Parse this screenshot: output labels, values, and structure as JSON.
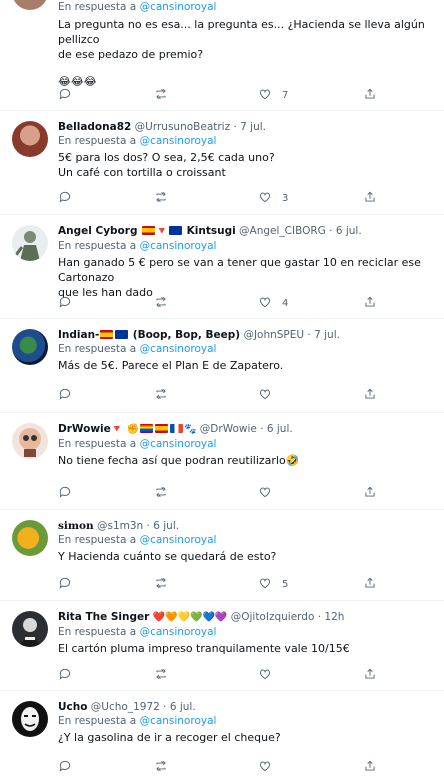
{
  "tweets": [
    {
      "id": "t0",
      "reply_prefix": "En respuesta a ",
      "reply_to": "@cansinoroyal",
      "text_lines": [
        "La pregunta no es esa... la pregunta es... ¿Hacienda se lleva algún pellizco",
        "de ese pedazo de premio?"
      ],
      "emoji_line": "😂😂😂",
      "likes": "7"
    },
    {
      "id": "t1",
      "name": "Belladona82",
      "handle": "@UrrusunoBeatriz",
      "date": "7 jul.",
      "reply_prefix": "En respuesta a ",
      "reply_to": "@cansinoroyal",
      "text_lines": [
        "5€ para los dos? O sea, 2,5€ cada uno?",
        "Un café con tortilla o croissant"
      ],
      "likes": "3"
    },
    {
      "id": "t2",
      "name": "Angel Cyborg",
      "name_suffix": "Kintsugi",
      "handle": "@Angel_CIBORG",
      "date": "6 jul.",
      "reply_prefix": "En respuesta a ",
      "reply_to": "@cansinoroyal",
      "text_lines": [
        "Han ganado 5 € pero se van a tener que gastar 10 en reciclar ese Cartonazo",
        "que les han dado"
      ],
      "likes": "4"
    },
    {
      "id": "t3",
      "name": "Indian-",
      "name_suffix": "(Boop, Bop, Beep)",
      "handle": "@JohnSPEU",
      "date": "7 jul.",
      "reply_prefix": "En respuesta a ",
      "reply_to": "@cansinoroyal",
      "text_lines": [
        "Más de 5€. Parece el Plan E de Zapatero."
      ],
      "likes": ""
    },
    {
      "id": "t4",
      "name": "DrWowie",
      "handle": "@DrWowie",
      "date": "6 jul.",
      "reply_prefix": "En respuesta a ",
      "reply_to": "@cansinoroyal",
      "text_lines": [
        "No tiene fecha así que podran reutilizarlo🤣"
      ],
      "likes": ""
    },
    {
      "id": "t5",
      "name": "simon",
      "handle": "@s1m3n",
      "date": "6 jul.",
      "reply_prefix": "En respuesta a ",
      "reply_to": "@cansinoroyal",
      "text_lines": [
        "Y Hacienda cuánto se quedará de esto?"
      ],
      "likes": "5"
    },
    {
      "id": "t6",
      "name": "Rita The Singer",
      "name_suffix": "❤️🧡💛💚💙💜",
      "handle": "@OjitoIzquierdo",
      "date": "12h",
      "reply_prefix": "En respuesta a ",
      "reply_to": "@cansinoroyal",
      "text_lines": [
        "El cartón pluma impreso tranquilamente vale 10/15€"
      ],
      "likes": ""
    },
    {
      "id": "t7",
      "name": "Ucho",
      "handle": "@Ucho_1972",
      "date": "6 jul.",
      "reply_prefix": "En respuesta a ",
      "reply_to": "@cansinoroyal",
      "text_lines": [
        "¿Y la gasolina de ir a recoger el cheque?"
      ],
      "likes": ""
    }
  ],
  "separator": " · ",
  "colors": {
    "accent": "#1d9bf0",
    "muted": "#536471",
    "text": "#0f1419",
    "divider": "#eff3f4"
  },
  "icons": [
    "reply-icon",
    "retweet-icon",
    "like-icon",
    "share-icon"
  ]
}
